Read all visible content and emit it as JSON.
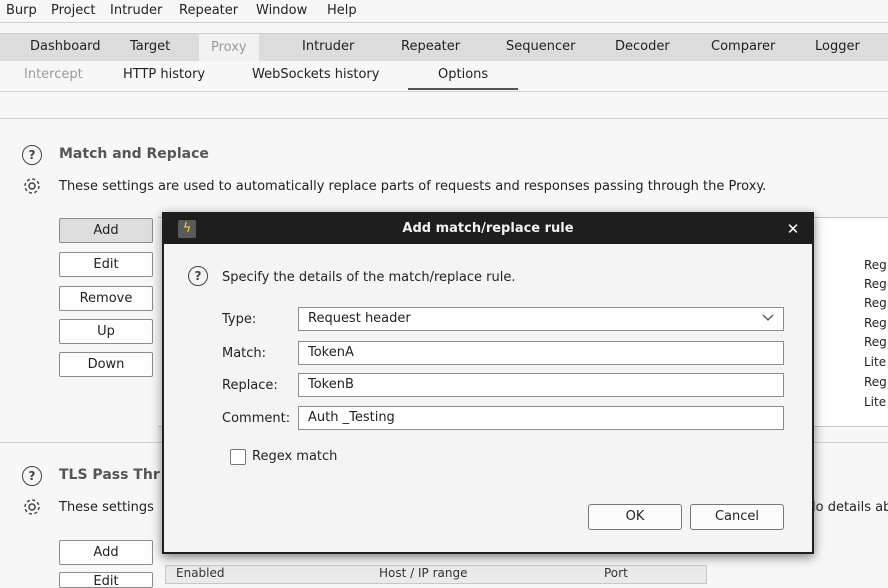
{
  "menubar": [
    "Burp",
    "Project",
    "Intruder",
    "Repeater",
    "Window",
    "Help"
  ],
  "main_tabs": [
    "Dashboard",
    "Target",
    "Proxy",
    "Intruder",
    "Repeater",
    "Sequencer",
    "Decoder",
    "Comparer",
    "Logger"
  ],
  "main_tabs_active": "Proxy",
  "sub_tabs": [
    "Intercept",
    "HTTP history",
    "WebSockets history",
    "Options"
  ],
  "sub_tabs_active": "Options",
  "match_replace": {
    "title": "Match and Replace",
    "description": "These settings are used to automatically replace parts of requests and responses passing through the Proxy.",
    "buttons": [
      "Add",
      "Edit",
      "Remove",
      "Up",
      "Down"
    ],
    "table_right_cells": [
      "Reg",
      "Reg",
      "Reg",
      "Reg",
      "Reg",
      "Lite",
      "Reg",
      "Lite"
    ]
  },
  "tls": {
    "title": "TLS Pass Thr",
    "description": "These settings",
    "description_right": "lo details ab",
    "buttons": [
      "Add",
      "Edit"
    ],
    "table_headers": [
      "Enabled",
      "Host / IP range",
      "Port"
    ]
  },
  "dialog": {
    "title": "Add match/replace rule",
    "close": "✕",
    "instruction": "Specify the details of the match/replace rule.",
    "type_label": "Type:",
    "type_value": "Request header",
    "match_label": "Match:",
    "match_value": "TokenA",
    "replace_label": "Replace:",
    "replace_value": "TokenB",
    "comment_label": "Comment:",
    "comment_value": "Auth _Testing",
    "regex_label": "Regex match",
    "regex_checked": false,
    "ok": "OK",
    "cancel": "Cancel"
  },
  "icons": {
    "help": "help-circle-icon",
    "settings": "gear-icon",
    "app": "burp-lightning-icon",
    "dropdown": "chevron-down-icon"
  }
}
